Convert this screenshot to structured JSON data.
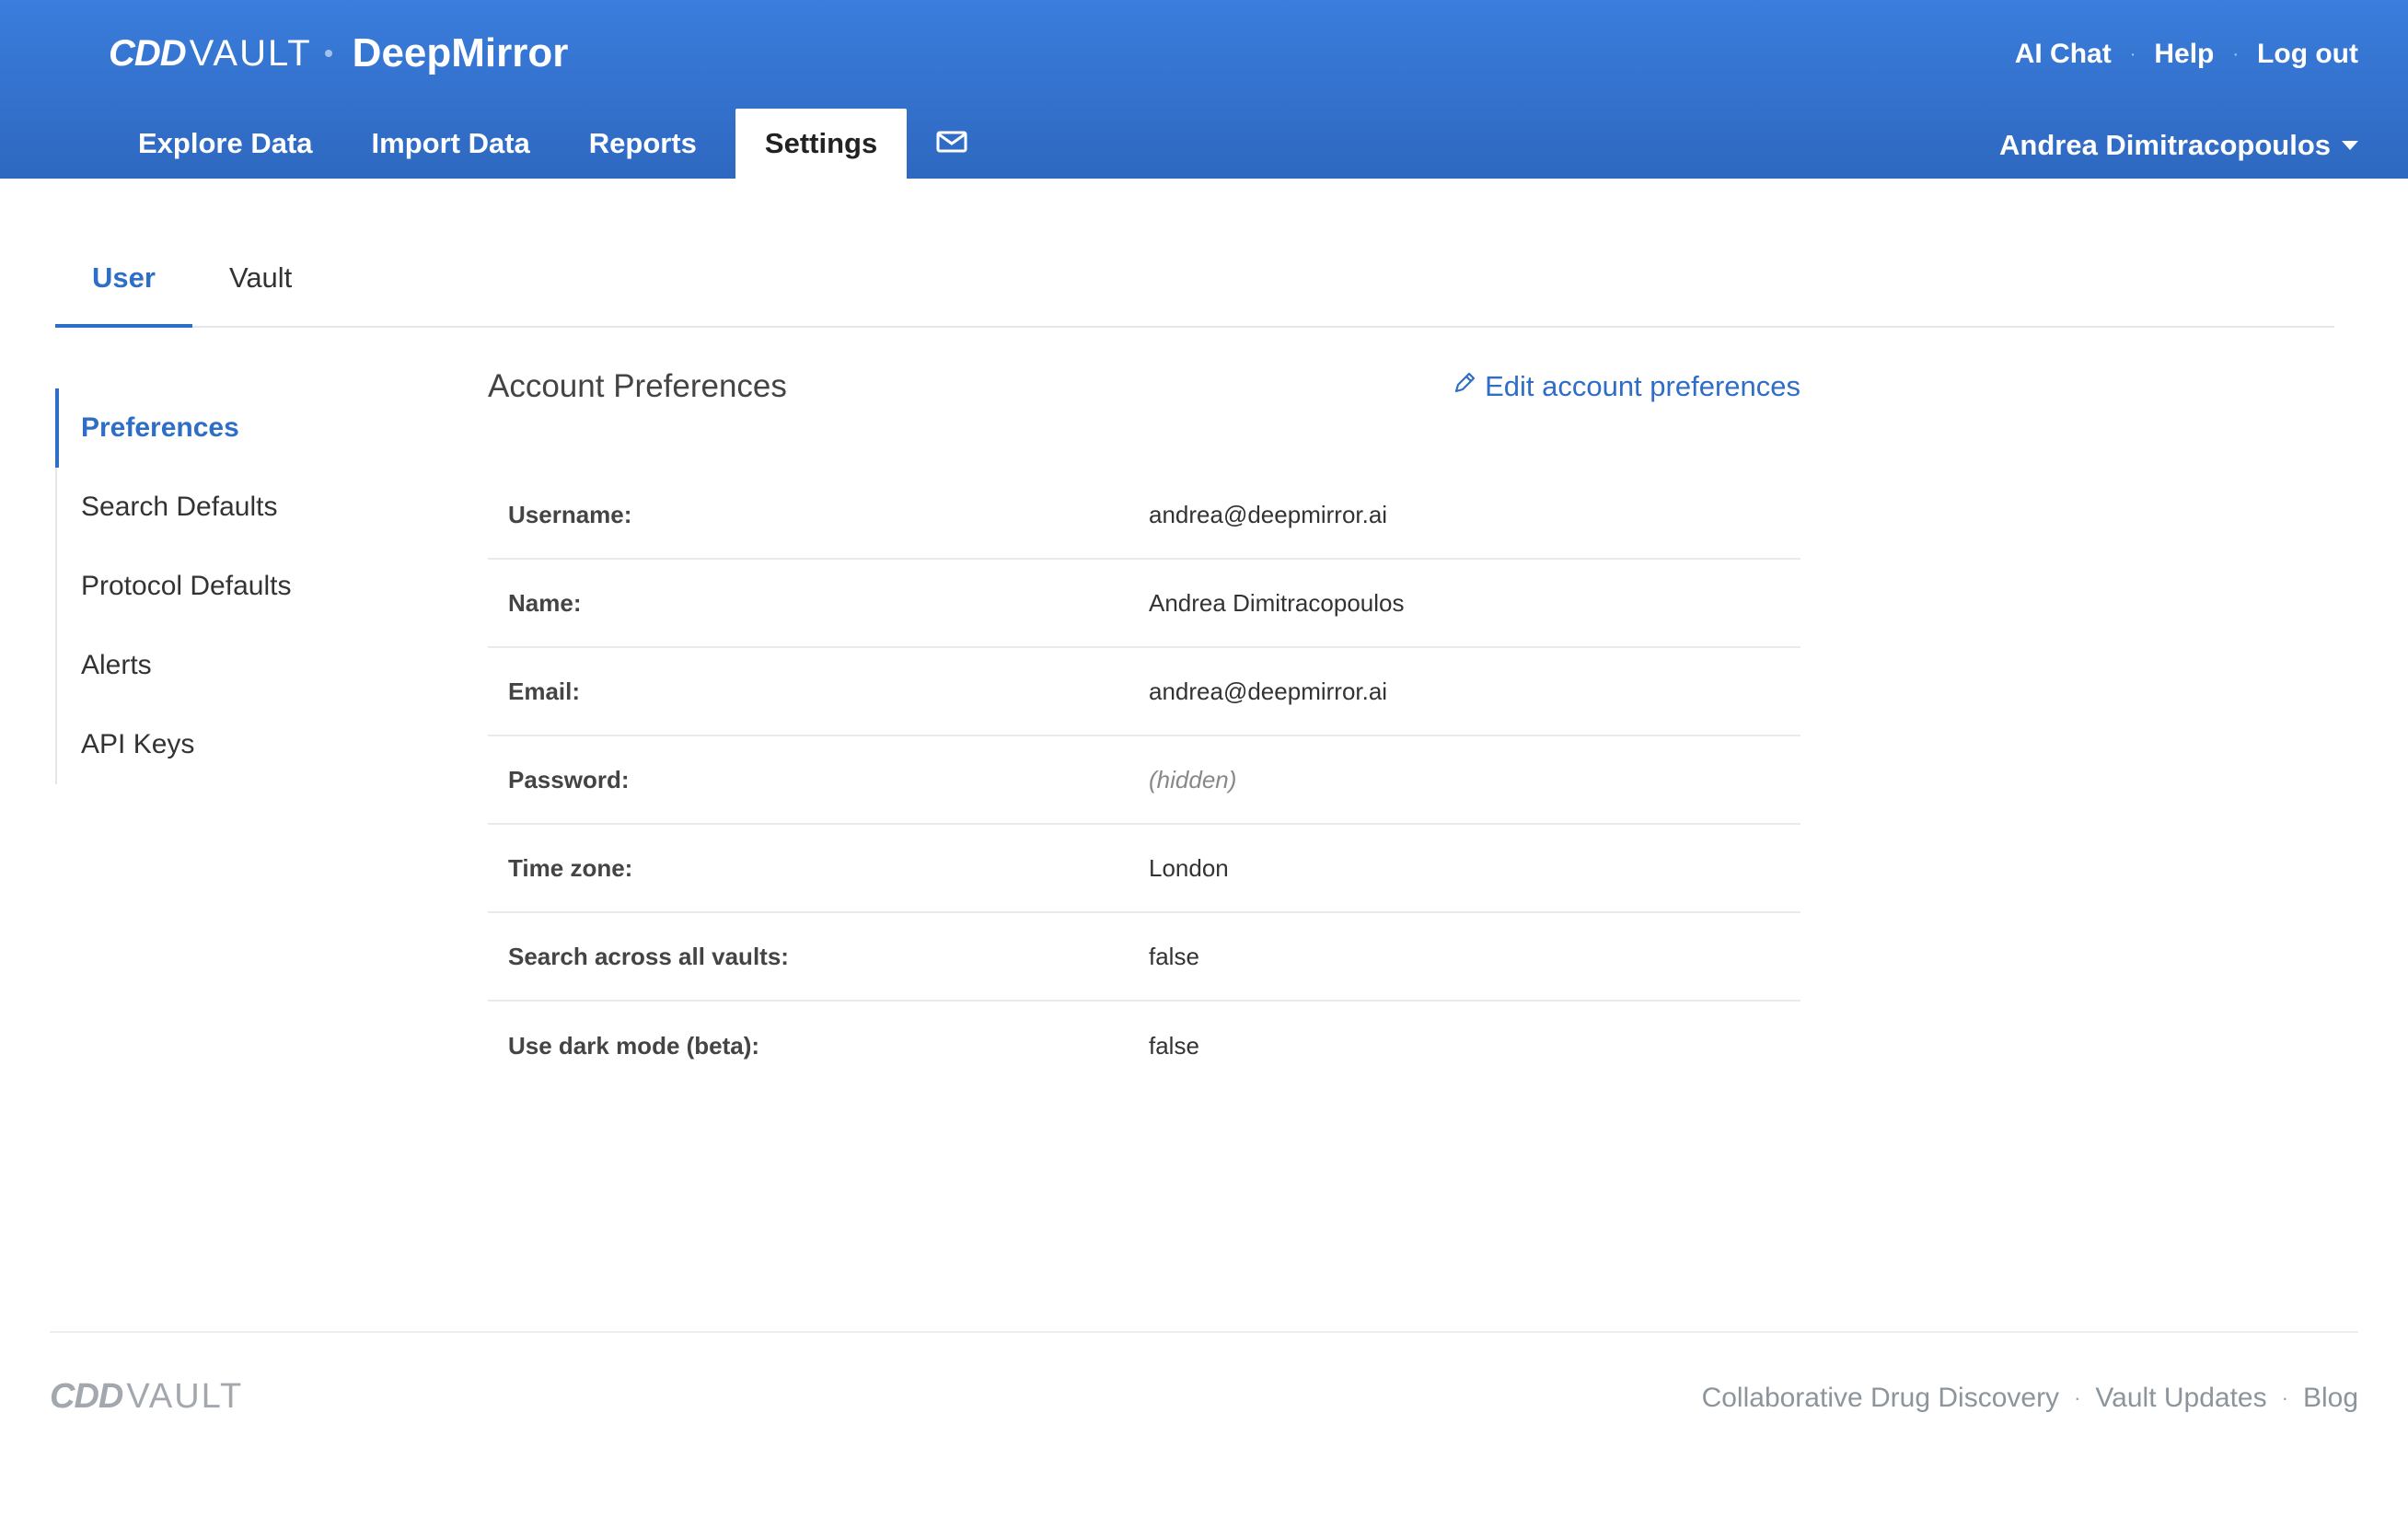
{
  "header": {
    "logo_mark": "CDD",
    "logo_vault": "VAULT",
    "org_name": "DeepMirror",
    "top_links": {
      "ai_chat": "AI Chat",
      "help": "Help",
      "logout": "Log out"
    },
    "nav": {
      "explore": "Explore Data",
      "import": "Import Data",
      "reports": "Reports",
      "settings": "Settings"
    },
    "user_name": "Andrea Dimitracopoulos"
  },
  "subtabs": {
    "user": "User",
    "vault": "Vault"
  },
  "sidebar": {
    "items": [
      {
        "label": "Preferences"
      },
      {
        "label": "Search Defaults"
      },
      {
        "label": "Protocol Defaults"
      },
      {
        "label": "Alerts"
      },
      {
        "label": "API Keys"
      }
    ]
  },
  "content": {
    "title": "Account Preferences",
    "edit_label": "Edit account preferences",
    "rows": [
      {
        "label": "Username:",
        "value": "andrea@deepmirror.ai"
      },
      {
        "label": "Name:",
        "value": "Andrea Dimitracopoulos"
      },
      {
        "label": "Email:",
        "value": "andrea@deepmirror.ai"
      },
      {
        "label": "Password:",
        "value": "(hidden)"
      },
      {
        "label": "Time zone:",
        "value": "London"
      },
      {
        "label": "Search across all vaults:",
        "value": "false"
      },
      {
        "label": "Use dark mode (beta):",
        "value": "false"
      }
    ]
  },
  "footer": {
    "logo_mark": "CDD",
    "logo_vault": "VAULT",
    "links": {
      "cdd": "Collaborative Drug Discovery",
      "updates": "Vault Updates",
      "blog": "Blog"
    }
  },
  "colors": {
    "header_blue": "#3a7ddc",
    "accent": "#2f6ec6"
  },
  "icons": {
    "mail": "envelope-icon",
    "edit": "pencil-icon",
    "caret": "caret-down-icon"
  }
}
